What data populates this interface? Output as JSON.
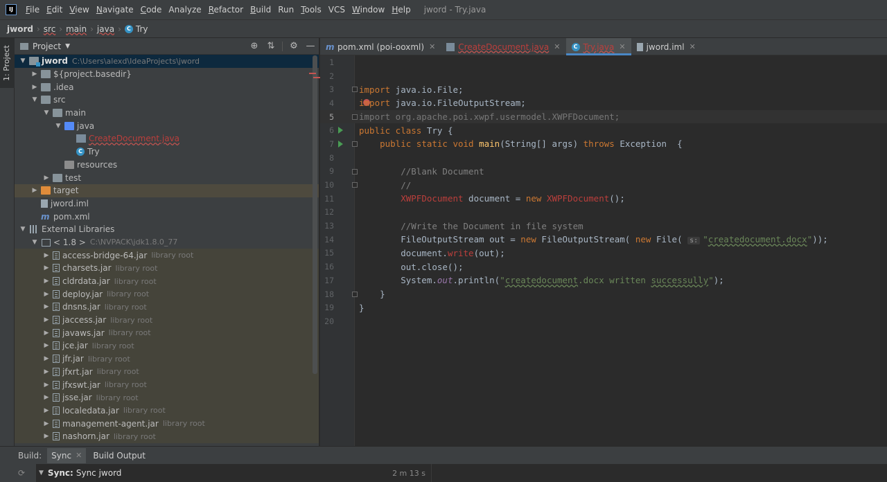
{
  "menubar": {
    "logo": "IJ",
    "items": [
      {
        "u": "F",
        "rest": "ile"
      },
      {
        "u": "E",
        "rest": "dit"
      },
      {
        "u": "V",
        "rest": "iew"
      },
      {
        "u": "N",
        "rest": "avigate"
      },
      {
        "u": "C",
        "rest": "ode"
      },
      {
        "u": "",
        "rest": "Analyze"
      },
      {
        "u": "R",
        "rest": "efactor"
      },
      {
        "u": "B",
        "rest": "uild"
      },
      {
        "u": "",
        "rest": "Run"
      },
      {
        "u": "T",
        "rest": "ools"
      },
      {
        "u": "",
        "rest": "VCS"
      },
      {
        "u": "W",
        "rest": "indow"
      },
      {
        "u": "H",
        "rest": "elp"
      }
    ],
    "window_title": "jword - Try.java"
  },
  "breadcrumb": [
    "jword",
    "src",
    "main",
    "java",
    "Try"
  ],
  "left_stripe": {
    "label": "1: Project"
  },
  "project_panel": {
    "title": "Project",
    "tree": [
      {
        "depth": 0,
        "arrow": "▼",
        "icon": "module",
        "label": "jword",
        "hint": "C:\\Users\\alexd\\IdeaProjects\\jword",
        "style": "selected",
        "bold": true
      },
      {
        "depth": 1,
        "arrow": "▶",
        "icon": "folder",
        "label": "${project.basedir}",
        "hint": ""
      },
      {
        "depth": 1,
        "arrow": "▶",
        "icon": "folder",
        "label": ".idea",
        "hint": ""
      },
      {
        "depth": 1,
        "arrow": "▼",
        "icon": "folder",
        "label": "src",
        "hint": ""
      },
      {
        "depth": 2,
        "arrow": "▼",
        "icon": "folder",
        "label": "main",
        "hint": ""
      },
      {
        "depth": 3,
        "arrow": "▼",
        "icon": "folder-blue",
        "label": "java",
        "hint": ""
      },
      {
        "depth": 4,
        "arrow": "",
        "icon": "java-file",
        "label": "CreateDocument.java",
        "hint": "",
        "err": true
      },
      {
        "depth": 4,
        "arrow": "",
        "icon": "java-c",
        "label": "Try",
        "hint": ""
      },
      {
        "depth": 3,
        "arrow": "",
        "icon": "folder-gray",
        "label": "resources",
        "hint": ""
      },
      {
        "depth": 2,
        "arrow": "▶",
        "icon": "folder",
        "label": "test",
        "hint": ""
      },
      {
        "depth": 1,
        "arrow": "▶",
        "icon": "folder-orange",
        "label": "target",
        "hint": "",
        "style": "excluded"
      },
      {
        "depth": 1,
        "arrow": "",
        "icon": "iml",
        "label": "jword.iml",
        "hint": ""
      },
      {
        "depth": 1,
        "arrow": "",
        "icon": "m",
        "label": "pom.xml",
        "hint": ""
      },
      {
        "depth": 0,
        "arrow": "▼",
        "icon": "lib",
        "label": "External Libraries",
        "hint": ""
      },
      {
        "depth": 1,
        "arrow": "▼",
        "icon": "jdk",
        "label": "< 1.8 >",
        "hint": "C:\\NVPACK\\jdk1.8.0_77"
      },
      {
        "depth": 2,
        "arrow": "▶",
        "icon": "jar",
        "label": "access-bridge-64.jar",
        "hint": "library root",
        "style": "libshade"
      },
      {
        "depth": 2,
        "arrow": "▶",
        "icon": "jar",
        "label": "charsets.jar",
        "hint": "library root",
        "style": "libshade"
      },
      {
        "depth": 2,
        "arrow": "▶",
        "icon": "jar",
        "label": "cldrdata.jar",
        "hint": "library root",
        "style": "libshade"
      },
      {
        "depth": 2,
        "arrow": "▶",
        "icon": "jar",
        "label": "deploy.jar",
        "hint": "library root",
        "style": "libshade"
      },
      {
        "depth": 2,
        "arrow": "▶",
        "icon": "jar",
        "label": "dnsns.jar",
        "hint": "library root",
        "style": "libshade"
      },
      {
        "depth": 2,
        "arrow": "▶",
        "icon": "jar",
        "label": "jaccess.jar",
        "hint": "library root",
        "style": "libshade"
      },
      {
        "depth": 2,
        "arrow": "▶",
        "icon": "jar",
        "label": "javaws.jar",
        "hint": "library root",
        "style": "libshade"
      },
      {
        "depth": 2,
        "arrow": "▶",
        "icon": "jar",
        "label": "jce.jar",
        "hint": "library root",
        "style": "libshade"
      },
      {
        "depth": 2,
        "arrow": "▶",
        "icon": "jar",
        "label": "jfr.jar",
        "hint": "library root",
        "style": "libshade"
      },
      {
        "depth": 2,
        "arrow": "▶",
        "icon": "jar",
        "label": "jfxrt.jar",
        "hint": "library root",
        "style": "libshade"
      },
      {
        "depth": 2,
        "arrow": "▶",
        "icon": "jar",
        "label": "jfxswt.jar",
        "hint": "library root",
        "style": "libshade"
      },
      {
        "depth": 2,
        "arrow": "▶",
        "icon": "jar",
        "label": "jsse.jar",
        "hint": "library root",
        "style": "libshade"
      },
      {
        "depth": 2,
        "arrow": "▶",
        "icon": "jar",
        "label": "localedata.jar",
        "hint": "library root",
        "style": "libshade"
      },
      {
        "depth": 2,
        "arrow": "▶",
        "icon": "jar",
        "label": "management-agent.jar",
        "hint": "library root",
        "style": "libshade"
      },
      {
        "depth": 2,
        "arrow": "▶",
        "icon": "jar",
        "label": "nashorn.jar",
        "hint": "library root",
        "style": "libshade"
      }
    ]
  },
  "editor": {
    "tabs": [
      {
        "icon": "m",
        "label": "pom.xml (poi-ooxml)",
        "active": false,
        "err": false,
        "close": true
      },
      {
        "icon": "j",
        "label": "CreateDocument.java",
        "active": false,
        "err": true,
        "close": true
      },
      {
        "icon": "c",
        "label": "Try.java",
        "active": true,
        "err": true,
        "close": true
      },
      {
        "icon": "iml",
        "label": "jword.iml",
        "active": false,
        "err": false,
        "close": true
      }
    ],
    "current_line": 5,
    "lines": [
      {
        "n": 1,
        "tokens": []
      },
      {
        "n": 2,
        "tokens": []
      },
      {
        "n": 3,
        "fold": true,
        "tokens": [
          [
            "kw",
            "import"
          ],
          [
            "",
            " java.io.File;"
          ]
        ]
      },
      {
        "n": 4,
        "bulb": true,
        "tokens": [
          [
            "kw",
            "import"
          ],
          [
            "",
            " java.io.FileOutputStream;"
          ]
        ]
      },
      {
        "n": 5,
        "fold": true,
        "tokens": [
          [
            "unused",
            "import org.apache."
          ],
          [
            "unused err",
            "poi"
          ],
          [
            "unused",
            ".xwpf.usermodel.XWPFDocument;"
          ]
        ]
      },
      {
        "n": 6,
        "run": true,
        "tokens": [
          [
            "kw",
            "public class"
          ],
          [
            "",
            " Try {"
          ]
        ]
      },
      {
        "n": 7,
        "run": true,
        "fold": true,
        "tokens": [
          [
            "",
            "    "
          ],
          [
            "kw",
            "public static void"
          ],
          [
            "",
            " "
          ],
          [
            "fn",
            "main"
          ],
          [
            "",
            "(String[] args) "
          ],
          [
            "kw",
            "throws"
          ],
          [
            "",
            " Exception  {"
          ]
        ]
      },
      {
        "n": 8,
        "tokens": []
      },
      {
        "n": 9,
        "fold": true,
        "tokens": [
          [
            "",
            "        "
          ],
          [
            "cm",
            "//Blank Document"
          ]
        ]
      },
      {
        "n": 10,
        "fold": true,
        "tokens": [
          [
            "",
            "        "
          ],
          [
            "cm",
            "//"
          ]
        ]
      },
      {
        "n": 11,
        "tokens": [
          [
            "",
            "        "
          ],
          [
            "err",
            "XWPFDocument"
          ],
          [
            "",
            " document = "
          ],
          [
            "kw",
            "new"
          ],
          [
            "",
            " "
          ],
          [
            "err",
            "XWPFDocument"
          ],
          [
            "",
            "();"
          ]
        ]
      },
      {
        "n": 12,
        "tokens": []
      },
      {
        "n": 13,
        "tokens": [
          [
            "",
            "        "
          ],
          [
            "cm",
            "//Write the Document in file system"
          ]
        ]
      },
      {
        "n": 14,
        "tokens": [
          [
            "",
            "        FileOutputStream out = "
          ],
          [
            "kw",
            "new"
          ],
          [
            "",
            " FileOutputStream( "
          ],
          [
            "kw",
            "new"
          ],
          [
            "",
            " File( "
          ],
          [
            "hint",
            "s:"
          ],
          [
            "str",
            "\""
          ],
          [
            "str-u",
            "createdocument.docx"
          ],
          [
            "str",
            "\""
          ],
          [
            "",
            "));"
          ]
        ]
      },
      {
        "n": 15,
        "tokens": [
          [
            "",
            "        document."
          ],
          [
            "err",
            "write"
          ],
          [
            "",
            "(out);"
          ]
        ]
      },
      {
        "n": 16,
        "tokens": [
          [
            "",
            "        out.close();"
          ]
        ]
      },
      {
        "n": 17,
        "tokens": [
          [
            "",
            "        System."
          ],
          [
            "it",
            "out"
          ],
          [
            "",
            ".println("
          ],
          [
            "str",
            "\""
          ],
          [
            "str-u",
            "createdocument"
          ],
          [
            "str",
            ".docx written "
          ],
          [
            "str-u",
            "successully"
          ],
          [
            "str",
            "\""
          ],
          [
            "",
            ");"
          ]
        ]
      },
      {
        "n": 18,
        "fold": true,
        "tokens": [
          [
            "",
            "    }"
          ]
        ]
      },
      {
        "n": 19,
        "tokens": [
          [
            "",
            "}"
          ]
        ]
      },
      {
        "n": 20,
        "tokens": []
      }
    ]
  },
  "build": {
    "label": "Build:",
    "tabs": [
      {
        "label": "Sync",
        "active": true
      },
      {
        "label": "Build Output",
        "active": false
      }
    ],
    "row": {
      "arrow": "▼",
      "name": "Sync:",
      "text": "Sync jword",
      "time": "2 m 13 s"
    }
  }
}
